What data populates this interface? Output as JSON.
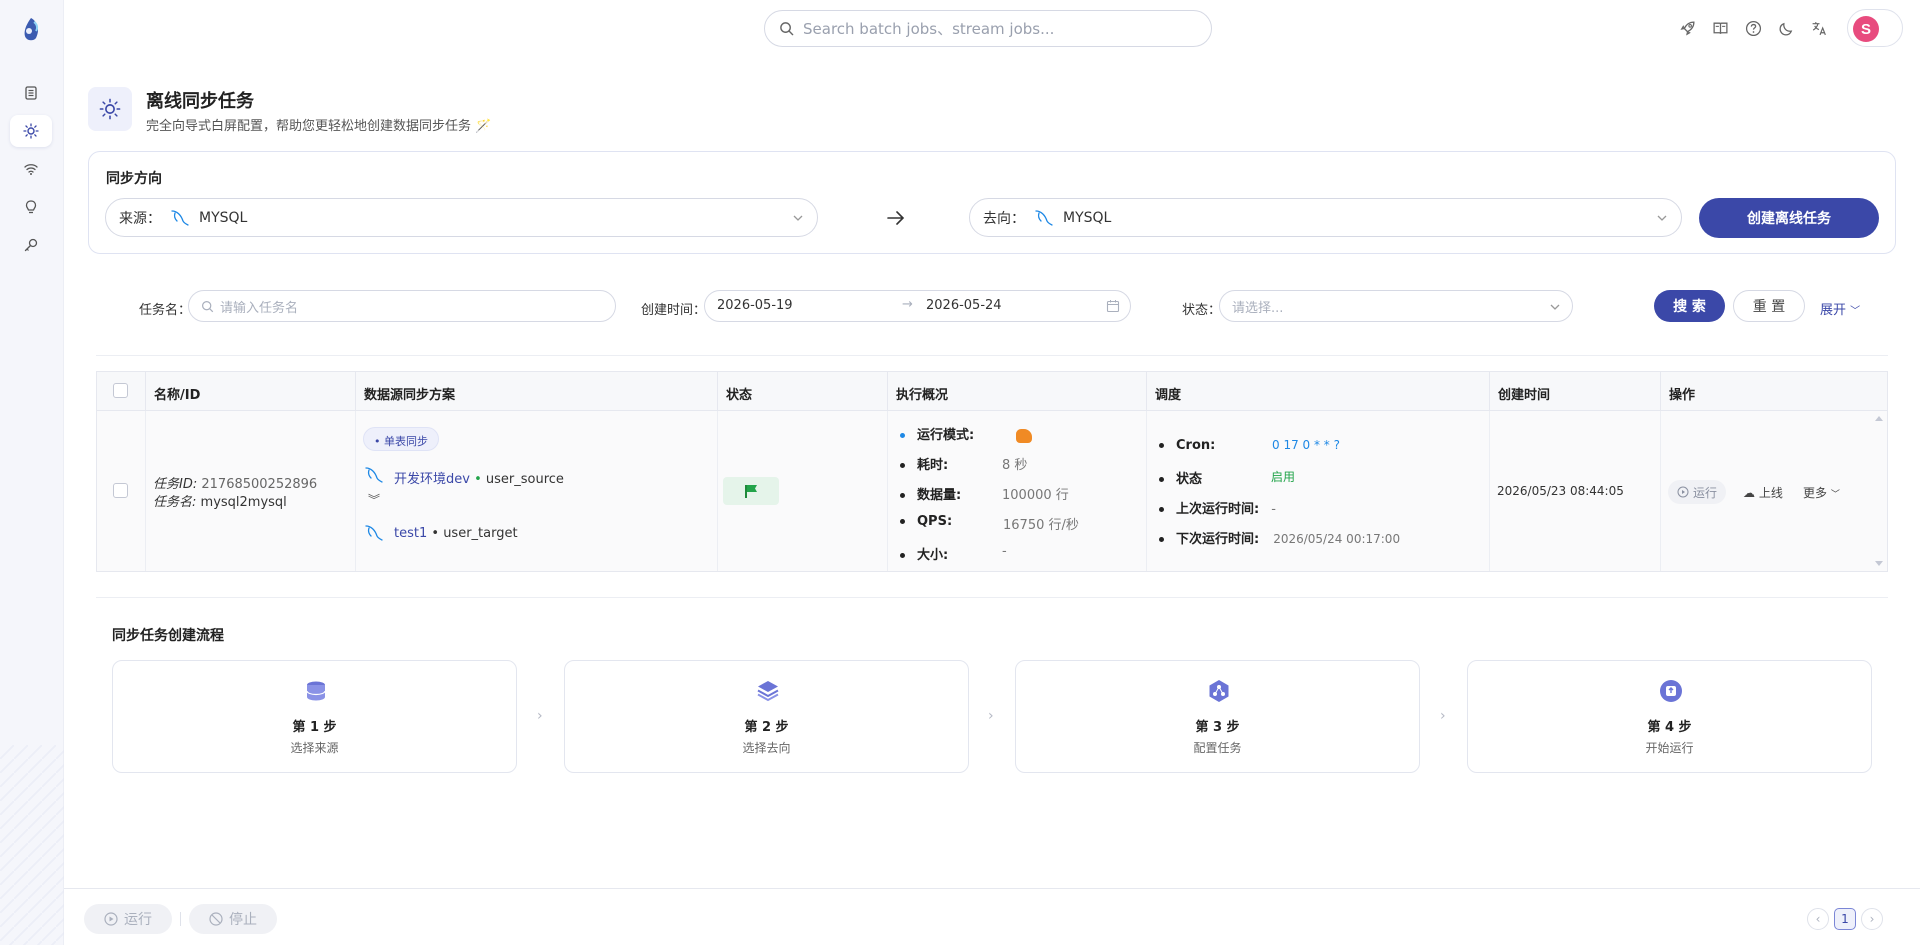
{
  "topbar": {
    "search_placeholder": "Search batch jobs、stream jobs...",
    "icons": [
      "rocket-icon",
      "book-icon",
      "help-icon",
      "moon-icon",
      "translate-icon"
    ],
    "avatar_letter": "S"
  },
  "sidebar": {
    "items": [
      "list-icon",
      "sun-icon",
      "wifi-icon",
      "bulb-icon",
      "search-key-icon"
    ],
    "active_index": 1
  },
  "header": {
    "title": "离线同步任务",
    "subtitle": "完全向导式白屏配置，帮助您更轻松地创建数据同步任务 🪄"
  },
  "direction": {
    "title": "同步方向",
    "source_label": "来源：",
    "source_value": "MYSQL",
    "target_label": "去向：",
    "target_value": "MYSQL",
    "create_button": "创建离线任务"
  },
  "filters": {
    "task_name_label": "任务名：",
    "task_name_placeholder": "请输入任务名",
    "created_time_label": "创建时间：",
    "date_start": "2026-05-19",
    "date_end": "2026-05-24",
    "status_label": "状态：",
    "status_placeholder": "请选择...",
    "search_button": "搜 索",
    "reset_button": "重 置",
    "expand_link": "展开"
  },
  "table": {
    "columns": [
      "名称/ID",
      "数据源同步方案",
      "状态",
      "执行概况",
      "调度",
      "创建时间",
      "操作"
    ],
    "row": {
      "id_label": "任务ID:",
      "id_value": "21768500252896",
      "name_label": "任务名:",
      "name_value": "mysql2mysql",
      "sync_tag": "单表同步",
      "source_env": "开发环境dev",
      "source_table": "user_source",
      "target_env": "test1",
      "target_table": "user_target",
      "exec": [
        {
          "label": "运行模式:",
          "value": ""
        },
        {
          "label": "耗时:",
          "value": "8 秒"
        },
        {
          "label": "数据量:",
          "value": "100000 行"
        },
        {
          "label": "QPS:",
          "value": "16750 行/秒"
        },
        {
          "label": "大小:",
          "value": "-"
        }
      ],
      "schedule": [
        {
          "label": "Cron:",
          "value": "0 17 0 * * ?"
        },
        {
          "label": "状态",
          "value": "启用"
        },
        {
          "label": "上次运行时间:",
          "value": "-"
        },
        {
          "label": "下次运行时间:",
          "value": "2026/05/24 00:17:00"
        }
      ],
      "created": "2026/05/23 08:44:05",
      "op_run": "运行",
      "op_online": "上线",
      "op_more": "更多"
    }
  },
  "flow": {
    "title": "同步任务创建流程",
    "steps": [
      {
        "name": "第 1 步",
        "desc": "选择来源"
      },
      {
        "name": "第 2 步",
        "desc": "选择去向"
      },
      {
        "name": "第 3 步",
        "desc": "配置任务"
      },
      {
        "name": "第 4 步",
        "desc": "开始运行"
      }
    ]
  },
  "footer": {
    "run_button": "运行",
    "stop_button": "停止",
    "current_page": "1"
  },
  "colors": {
    "primary": "#3b48a8",
    "accent_blue": "#1e88e5",
    "success": "#22a44a",
    "avatar": "#e84b7e"
  }
}
